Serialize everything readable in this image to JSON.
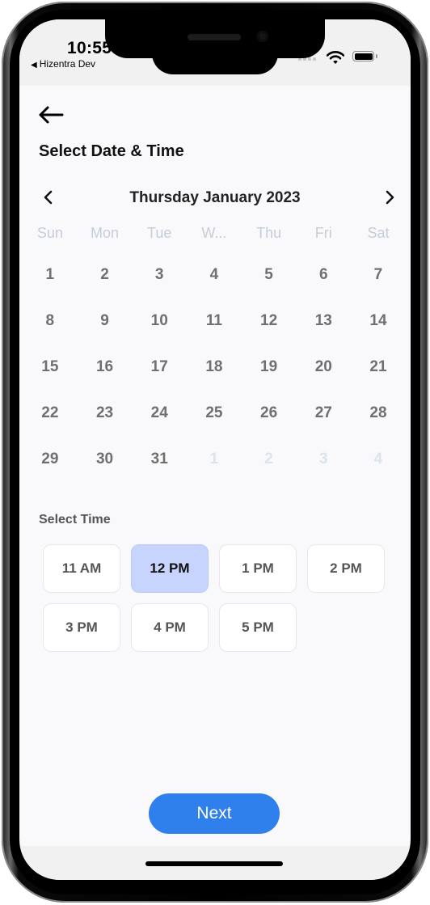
{
  "status_bar": {
    "time": "10:55",
    "back_app_label": "Hizentra Dev"
  },
  "header": {
    "title": "Select Date & Time"
  },
  "calendar": {
    "month_label": "Thursday January 2023",
    "weekdays": [
      "Sun",
      "Mon",
      "Tue",
      "W...",
      "Thu",
      "Fri",
      "Sat"
    ],
    "days": [
      {
        "label": "1",
        "muted": false
      },
      {
        "label": "2",
        "muted": false
      },
      {
        "label": "3",
        "muted": false
      },
      {
        "label": "4",
        "muted": false
      },
      {
        "label": "5",
        "muted": false
      },
      {
        "label": "6",
        "muted": false
      },
      {
        "label": "7",
        "muted": false
      },
      {
        "label": "8",
        "muted": false
      },
      {
        "label": "9",
        "muted": false
      },
      {
        "label": "10",
        "muted": false
      },
      {
        "label": "11",
        "muted": false
      },
      {
        "label": "12",
        "muted": false
      },
      {
        "label": "13",
        "muted": false
      },
      {
        "label": "14",
        "muted": false
      },
      {
        "label": "15",
        "muted": false
      },
      {
        "label": "16",
        "muted": false
      },
      {
        "label": "17",
        "muted": false
      },
      {
        "label": "18",
        "muted": false
      },
      {
        "label": "19",
        "muted": false
      },
      {
        "label": "20",
        "muted": false
      },
      {
        "label": "21",
        "muted": false
      },
      {
        "label": "22",
        "muted": false
      },
      {
        "label": "23",
        "muted": false
      },
      {
        "label": "24",
        "muted": false
      },
      {
        "label": "25",
        "muted": false
      },
      {
        "label": "26",
        "muted": false
      },
      {
        "label": "27",
        "muted": false
      },
      {
        "label": "28",
        "muted": false
      },
      {
        "label": "29",
        "muted": false
      },
      {
        "label": "30",
        "muted": false
      },
      {
        "label": "31",
        "muted": false
      },
      {
        "label": "1",
        "muted": true
      },
      {
        "label": "2",
        "muted": true
      },
      {
        "label": "3",
        "muted": true
      },
      {
        "label": "4",
        "muted": true
      }
    ]
  },
  "time_section": {
    "label": "Select Time",
    "slots": [
      {
        "label": "11 AM",
        "selected": false
      },
      {
        "label": "12 PM",
        "selected": true
      },
      {
        "label": "1 PM",
        "selected": false
      },
      {
        "label": "2 PM",
        "selected": false
      },
      {
        "label": "3 PM",
        "selected": false
      },
      {
        "label": "4 PM",
        "selected": false
      },
      {
        "label": "5 PM",
        "selected": false
      }
    ]
  },
  "footer": {
    "next_label": "Next"
  },
  "colors": {
    "accent": "#2f80ed",
    "selected_slot": "#c7d4fd",
    "background": "#f9f9fb"
  }
}
